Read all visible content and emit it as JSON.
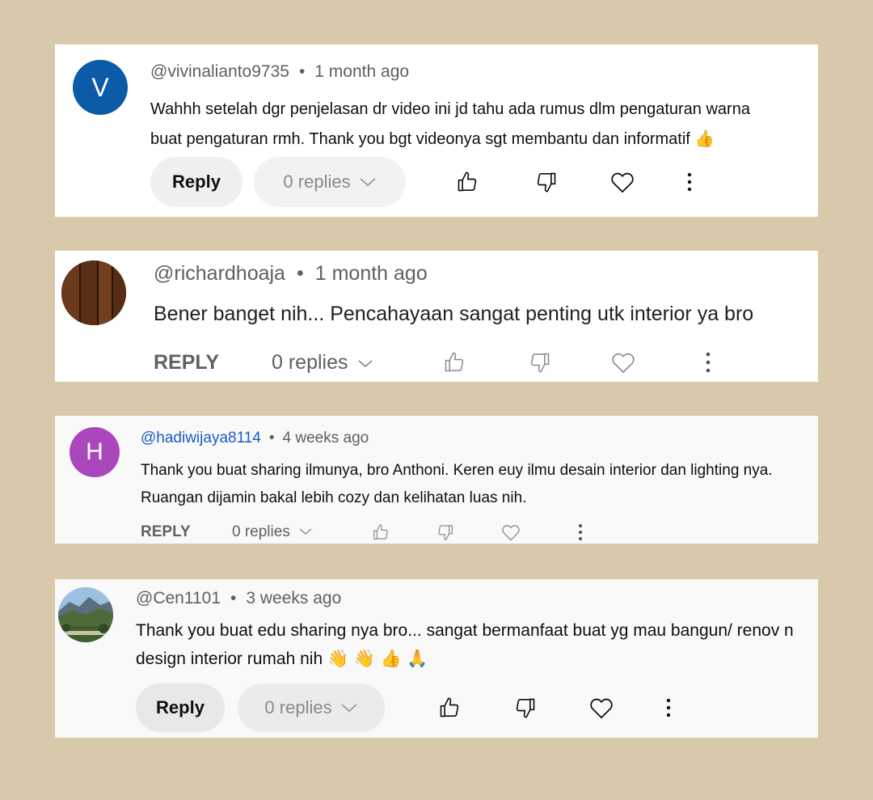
{
  "comments": [
    {
      "author": "@vivinalianto9735",
      "separator": "•",
      "time": "1 month ago",
      "avatar_letter": "V",
      "avatar_color": "#0b5ba8",
      "lines": [
        "Wahhh setelah dgr penjelasan dr video ini jd tahu ada rumus dlm pengaturan warna",
        "buat pengaturan rmh. Thank you bgt videonya sgt membantu dan informatif"
      ],
      "emoji_line2": "👍",
      "reply_label": "Reply",
      "replies_label": "0 replies",
      "chevron": "∨"
    },
    {
      "author": "@richardhoaja",
      "separator": "•",
      "time": "1 month ago",
      "avatar_image": "wood-texture",
      "lines": [
        "Bener banget nih... Pencahayaan sangat penting utk interior ya bro"
      ],
      "reply_label": "REPLY",
      "replies_label": "0 replies",
      "chevron": "∨"
    },
    {
      "author": "@hadiwijaya8114",
      "separator": "•",
      "time": "4 weeks ago",
      "avatar_letter": "H",
      "avatar_color": "#ab47bc",
      "author_color": "#1a5bc4",
      "lines": [
        "Thank you buat sharing ilmunya, bro Anthoni. Keren euy ilmu desain interior dan lighting nya.",
        "Ruangan dijamin bakal lebih cozy dan kelihatan luas nih."
      ],
      "reply_label": "REPLY",
      "replies_label": "0 replies",
      "chevron": "∨"
    },
    {
      "author": "@Cen1101",
      "separator": "•",
      "time": "3 weeks ago",
      "avatar_image": "mountain-landscape",
      "lines": [
        "Thank you buat edu sharing nya bro... sangat bermanfaat buat yg mau bangun/ renov n",
        "design interior rumah nih"
      ],
      "emoji_line2": "👋 👋 👍 🙏",
      "reply_label": "Reply",
      "replies_label": "0 replies",
      "chevron": "∨"
    }
  ],
  "icons": [
    "thumbs-up-icon",
    "thumbs-down-icon",
    "heart-icon",
    "more-vert-icon"
  ],
  "colors": {
    "background": "#d9c9ab",
    "card": "#ffffff",
    "card_alt": "#f9f9f9",
    "text": "#0f0f0f",
    "muted": "#606060"
  }
}
